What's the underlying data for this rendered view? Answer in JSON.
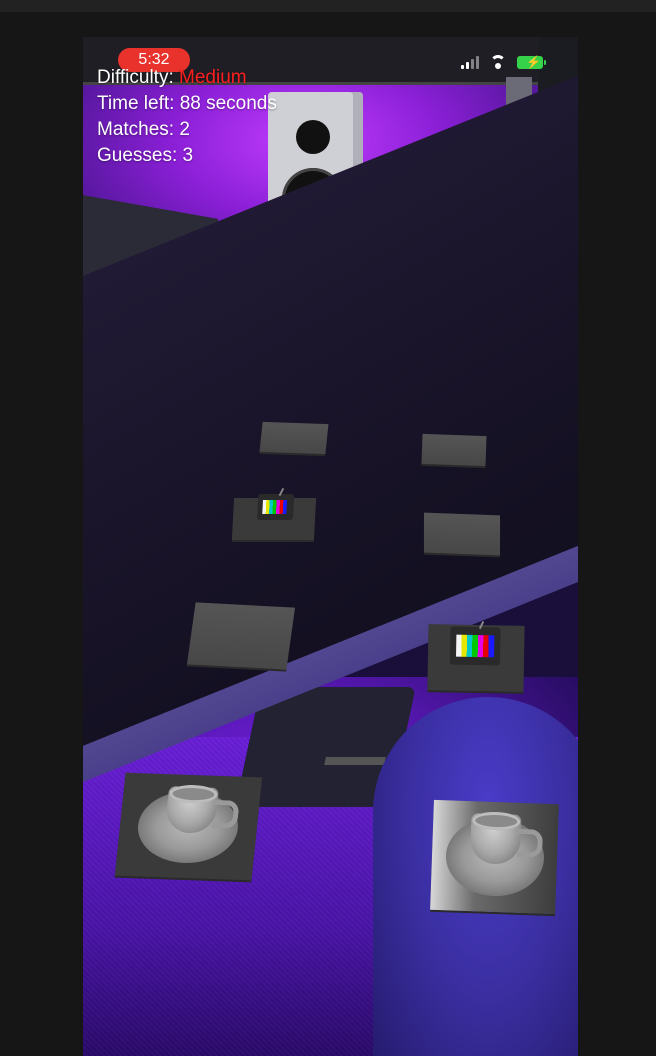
{
  "status_bar": {
    "time": "5:32",
    "battery_color": "#36d24a",
    "time_pill_color": "#e8322b"
  },
  "hud": {
    "difficulty_label": "Difficulty:",
    "difficulty_value": "Medium",
    "difficulty_value_color": "#ff1e1e",
    "time_left": "Time left: 88 seconds",
    "matches": "Matches: 2",
    "guesses": "Guesses: 3"
  },
  "cards": [
    {
      "id": "card-1",
      "state": "face-down"
    },
    {
      "id": "card-2",
      "state": "face-down"
    },
    {
      "id": "card-3",
      "state": "face-up",
      "icon": "tv-icon"
    },
    {
      "id": "card-4",
      "state": "face-down"
    },
    {
      "id": "card-5",
      "state": "face-down"
    },
    {
      "id": "card-6",
      "state": "face-up",
      "icon": "tv-icon"
    },
    {
      "id": "card-7",
      "state": "face-up",
      "icon": "teacup-icon"
    },
    {
      "id": "card-8",
      "state": "face-up",
      "icon": "teacup-icon"
    }
  ]
}
